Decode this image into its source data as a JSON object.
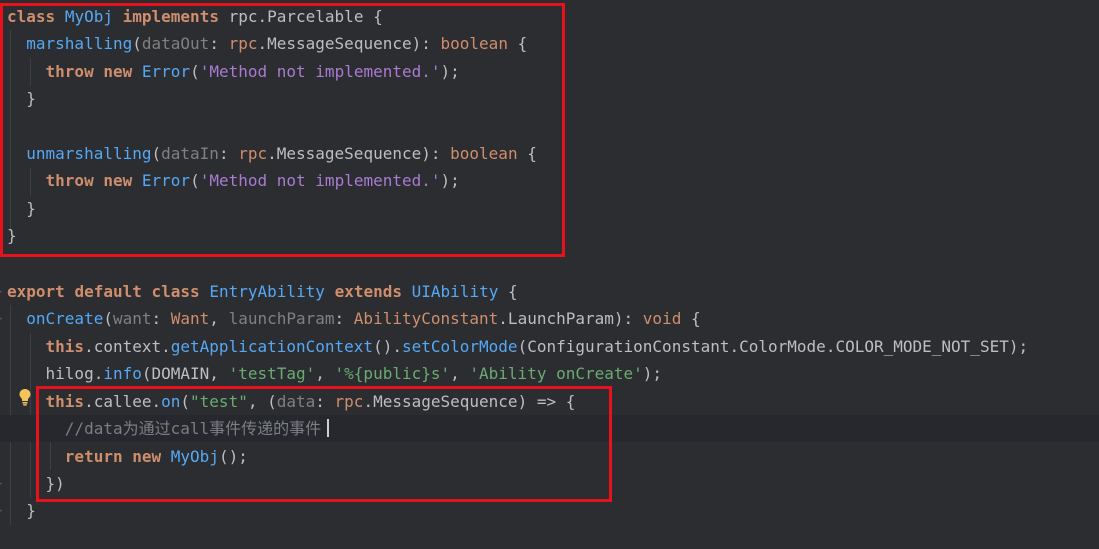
{
  "lines": [
    {
      "tokens": [
        {
          "t": "class",
          "c": "kw"
        },
        {
          "t": " ",
          "c": "punc"
        },
        {
          "t": "MyObj",
          "c": "fn"
        },
        {
          "t": " ",
          "c": "punc"
        },
        {
          "t": "implements",
          "c": "kw"
        },
        {
          "t": " rpc.Parcelable {",
          "c": "punc"
        }
      ]
    },
    {
      "tokens": [
        {
          "t": "  ",
          "c": "punc"
        },
        {
          "t": "marshalling",
          "c": "fn"
        },
        {
          "t": "(",
          "c": "punc"
        },
        {
          "t": "dataOut",
          "c": "param"
        },
        {
          "t": ": ",
          "c": "punc"
        },
        {
          "t": "rpc",
          "c": "kwn"
        },
        {
          "t": ".MessageSequence): ",
          "c": "punc"
        },
        {
          "t": "boolean",
          "c": "kwn"
        },
        {
          "t": " {",
          "c": "punc"
        }
      ]
    },
    {
      "tokens": [
        {
          "t": "    ",
          "c": "punc"
        },
        {
          "t": "throw",
          "c": "kw"
        },
        {
          "t": " ",
          "c": "punc"
        },
        {
          "t": "new",
          "c": "kw"
        },
        {
          "t": " ",
          "c": "punc"
        },
        {
          "t": "Error",
          "c": "fn"
        },
        {
          "t": "(",
          "c": "punc"
        },
        {
          "t": "'Method not implemented.'",
          "c": "strp"
        },
        {
          "t": ");",
          "c": "punc"
        }
      ]
    },
    {
      "tokens": [
        {
          "t": "  }",
          "c": "punc"
        }
      ]
    },
    {
      "tokens": [
        {
          "t": "",
          "c": "punc"
        }
      ]
    },
    {
      "tokens": [
        {
          "t": "  ",
          "c": "punc"
        },
        {
          "t": "unmarshalling",
          "c": "fn"
        },
        {
          "t": "(",
          "c": "punc"
        },
        {
          "t": "dataIn",
          "c": "param"
        },
        {
          "t": ": ",
          "c": "punc"
        },
        {
          "t": "rpc",
          "c": "kwn"
        },
        {
          "t": ".MessageSequence): ",
          "c": "punc"
        },
        {
          "t": "boolean",
          "c": "kwn"
        },
        {
          "t": " {",
          "c": "punc"
        }
      ]
    },
    {
      "tokens": [
        {
          "t": "    ",
          "c": "punc"
        },
        {
          "t": "throw",
          "c": "kw"
        },
        {
          "t": " ",
          "c": "punc"
        },
        {
          "t": "new",
          "c": "kw"
        },
        {
          "t": " ",
          "c": "punc"
        },
        {
          "t": "Error",
          "c": "fn"
        },
        {
          "t": "(",
          "c": "punc"
        },
        {
          "t": "'Method not implemented.'",
          "c": "strp"
        },
        {
          "t": ");",
          "c": "punc"
        }
      ]
    },
    {
      "tokens": [
        {
          "t": "  }",
          "c": "punc"
        }
      ]
    },
    {
      "tokens": [
        {
          "t": "}",
          "c": "punc"
        }
      ]
    },
    {
      "tokens": [
        {
          "t": "",
          "c": "punc"
        }
      ]
    },
    {
      "tokens": [
        {
          "t": "export",
          "c": "kw"
        },
        {
          "t": " ",
          "c": "punc"
        },
        {
          "t": "default",
          "c": "kw"
        },
        {
          "t": " ",
          "c": "punc"
        },
        {
          "t": "class",
          "c": "kw"
        },
        {
          "t": " ",
          "c": "punc"
        },
        {
          "t": "EntryAbility",
          "c": "fn"
        },
        {
          "t": " ",
          "c": "punc"
        },
        {
          "t": "extends",
          "c": "kw"
        },
        {
          "t": " ",
          "c": "punc"
        },
        {
          "t": "UIAbility",
          "c": "fn"
        },
        {
          "t": " {",
          "c": "punc"
        }
      ]
    },
    {
      "tokens": [
        {
          "t": "  ",
          "c": "punc"
        },
        {
          "t": "onCreate",
          "c": "fn"
        },
        {
          "t": "(",
          "c": "punc"
        },
        {
          "t": "want",
          "c": "param"
        },
        {
          "t": ": ",
          "c": "punc"
        },
        {
          "t": "Want",
          "c": "kwn"
        },
        {
          "t": ", ",
          "c": "punc"
        },
        {
          "t": "launchParam",
          "c": "param"
        },
        {
          "t": ": ",
          "c": "punc"
        },
        {
          "t": "AbilityConstant",
          "c": "kwn"
        },
        {
          "t": ".LaunchParam): ",
          "c": "punc"
        },
        {
          "t": "void",
          "c": "kwn"
        },
        {
          "t": " {",
          "c": "punc"
        }
      ]
    },
    {
      "tokens": [
        {
          "t": "    ",
          "c": "punc"
        },
        {
          "t": "this",
          "c": "kw"
        },
        {
          "t": ".context.",
          "c": "punc"
        },
        {
          "t": "getApplicationContext",
          "c": "fn"
        },
        {
          "t": "().",
          "c": "punc"
        },
        {
          "t": "setColorMode",
          "c": "fn"
        },
        {
          "t": "(ConfigurationConstant.ColorMode.COLOR_MODE_NOT_SET);",
          "c": "punc"
        }
      ]
    },
    {
      "tokens": [
        {
          "t": "    hilog.",
          "c": "punc"
        },
        {
          "t": "info",
          "c": "fn"
        },
        {
          "t": "(DOMAIN, ",
          "c": "punc"
        },
        {
          "t": "'testTag'",
          "c": "str"
        },
        {
          "t": ", ",
          "c": "punc"
        },
        {
          "t": "'%{public}s'",
          "c": "str"
        },
        {
          "t": ", ",
          "c": "punc"
        },
        {
          "t": "'Ability onCreate'",
          "c": "str"
        },
        {
          "t": ");",
          "c": "punc"
        }
      ]
    },
    {
      "tokens": [
        {
          "t": "    ",
          "c": "punc"
        },
        {
          "t": "this",
          "c": "kw"
        },
        {
          "t": ".callee.",
          "c": "punc"
        },
        {
          "t": "on",
          "c": "fn"
        },
        {
          "t": "(",
          "c": "punc"
        },
        {
          "t": "\"test\"",
          "c": "str"
        },
        {
          "t": ", (",
          "c": "punc"
        },
        {
          "t": "data",
          "c": "param"
        },
        {
          "t": ": ",
          "c": "punc"
        },
        {
          "t": "rpc",
          "c": "kwn"
        },
        {
          "t": ".MessageSequence) => {",
          "c": "punc"
        }
      ]
    },
    {
      "tokens": [
        {
          "t": "      ",
          "c": "punc"
        },
        {
          "t": "//data为通过call事件传递的事件",
          "c": "comment"
        }
      ]
    },
    {
      "tokens": [
        {
          "t": "      ",
          "c": "punc"
        },
        {
          "t": "return",
          "c": "kw"
        },
        {
          "t": " ",
          "c": "punc"
        },
        {
          "t": "new",
          "c": "kw"
        },
        {
          "t": " ",
          "c": "punc"
        },
        {
          "t": "MyObj",
          "c": "fn"
        },
        {
          "t": "();",
          "c": "punc"
        }
      ]
    },
    {
      "tokens": [
        {
          "t": "    })",
          "c": "punc"
        }
      ]
    },
    {
      "tokens": [
        {
          "t": "  }",
          "c": "punc"
        }
      ]
    }
  ],
  "highlight_colors": {
    "annotation_box": "#e8121d",
    "background": "#2b2d30",
    "keyword": "#cf8e6d",
    "function": "#56a8f5",
    "string": "#6aab73"
  },
  "gutter_icons": [
    "fold-icon",
    "lightbulb-icon"
  ]
}
